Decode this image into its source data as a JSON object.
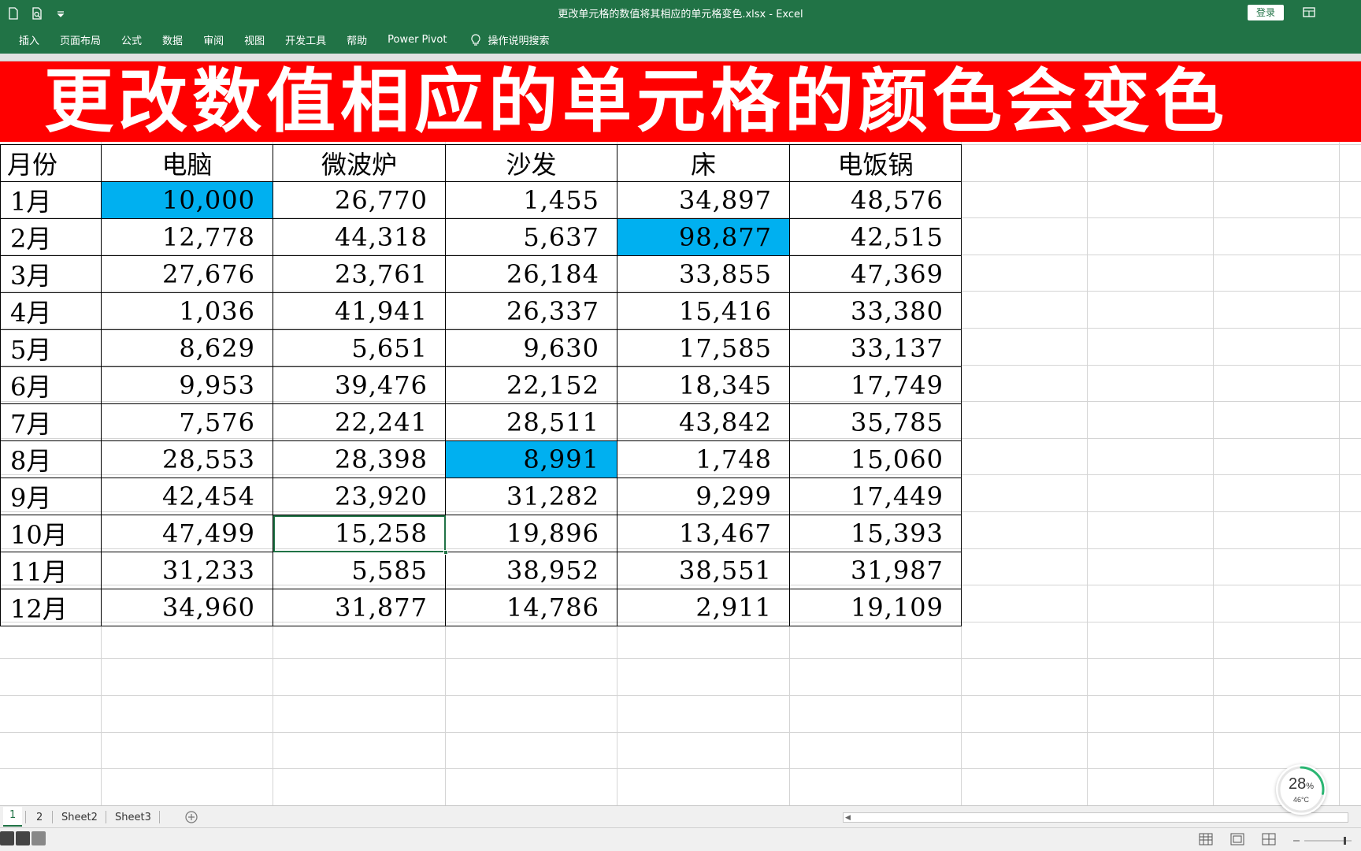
{
  "window": {
    "title": "更改单元格的数值将其相应的单元格变色.xlsx  -  Excel",
    "login_label": "登录"
  },
  "ribbon": {
    "tabs": [
      {
        "label": "插入"
      },
      {
        "label": "页面布局"
      },
      {
        "label": "公式"
      },
      {
        "label": "数据"
      },
      {
        "label": "审阅"
      },
      {
        "label": "视图"
      },
      {
        "label": "开发工具"
      },
      {
        "label": "帮助"
      },
      {
        "label": "Power Pivot"
      }
    ],
    "tell_me": "操作说明搜索"
  },
  "banner": {
    "text": "更改数值相应的单元格的颜色会变色",
    "background": "#ff0000"
  },
  "table": {
    "headers": [
      "月份",
      "电脑",
      "微波炉",
      "沙发",
      "床",
      "电饭锅"
    ],
    "rows": [
      {
        "month": "1月",
        "values": [
          "10,000",
          "26,770",
          "1,455",
          "34,897",
          "48,576"
        ]
      },
      {
        "month": "2月",
        "values": [
          "12,778",
          "44,318",
          "5,637",
          "98,877",
          "42,515"
        ]
      },
      {
        "month": "3月",
        "values": [
          "27,676",
          "23,761",
          "26,184",
          "33,855",
          "47,369"
        ]
      },
      {
        "month": "4月",
        "values": [
          "1,036",
          "41,941",
          "26,337",
          "15,416",
          "33,380"
        ]
      },
      {
        "month": "5月",
        "values": [
          "8,629",
          "5,651",
          "9,630",
          "17,585",
          "33,137"
        ]
      },
      {
        "month": "6月",
        "values": [
          "9,953",
          "39,476",
          "22,152",
          "18,345",
          "17,749"
        ]
      },
      {
        "month": "7月",
        "values": [
          "7,576",
          "22,241",
          "28,511",
          "43,842",
          "35,785"
        ]
      },
      {
        "month": "8月",
        "values": [
          "28,553",
          "28,398",
          "8,991",
          "1,748",
          "15,060"
        ]
      },
      {
        "month": "9月",
        "values": [
          "42,454",
          "23,920",
          "31,282",
          "9,299",
          "17,449"
        ]
      },
      {
        "month": "10月",
        "values": [
          "47,499",
          "15,258",
          "19,896",
          "13,467",
          "15,393"
        ]
      },
      {
        "month": "11月",
        "values": [
          "31,233",
          "5,585",
          "38,952",
          "38,551",
          "31,987"
        ]
      },
      {
        "month": "12月",
        "values": [
          "34,960",
          "31,877",
          "14,786",
          "2,911",
          "19,109"
        ]
      }
    ],
    "highlighted_cells": [
      {
        "row": 0,
        "col": 0
      },
      {
        "row": 1,
        "col": 3
      },
      {
        "row": 7,
        "col": 2
      }
    ],
    "selected_cell": {
      "row": 9,
      "col": 1
    },
    "highlight_color": "#00b0f0"
  },
  "sheets": {
    "tabs": [
      {
        "label": "1",
        "active": true
      },
      {
        "label": "2",
        "active": false
      },
      {
        "label": "Sheet2",
        "active": false
      },
      {
        "label": "Sheet3",
        "active": false
      }
    ]
  },
  "perf": {
    "value": "28",
    "unit": "%",
    "temp": "46°C"
  },
  "colors": {
    "excel_green": "#217346"
  }
}
